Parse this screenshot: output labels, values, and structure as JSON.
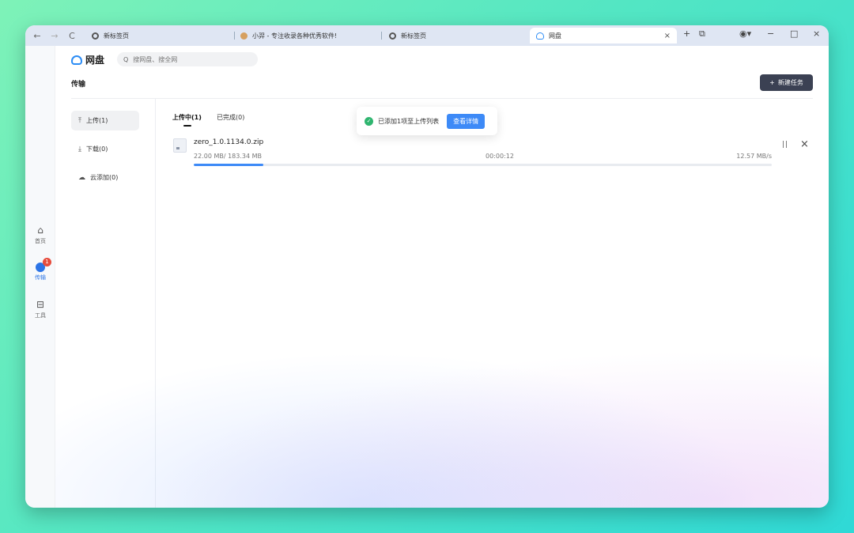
{
  "browser": {
    "tabs": [
      {
        "label": "新标签页"
      },
      {
        "label": "小羿 - 专注收录各种优秀软件!"
      },
      {
        "label": "新标签页"
      },
      {
        "label": "网盘"
      }
    ]
  },
  "app": {
    "logo_text": "网盘",
    "search_placeholder": "搜网盘、搜全网",
    "page_title": "传输",
    "new_task_label": "新建任务"
  },
  "sidebar": {
    "items": [
      {
        "label": "首页"
      },
      {
        "label": "传输",
        "badge": "1"
      },
      {
        "label": "工具"
      }
    ]
  },
  "categories": [
    {
      "label": "上传(1)"
    },
    {
      "label": "下载(0)"
    },
    {
      "label": "云添加(0)"
    }
  ],
  "subtabs": [
    {
      "label": "上传中(1)"
    },
    {
      "label": "已完成(0)"
    }
  ],
  "file": {
    "name": "zero_1.0.1134.0.zip",
    "size": "22.00 MB/ 183.34 MB",
    "time": "00:00:12",
    "speed": "12.57 MB/s",
    "progress": 0.12
  },
  "toast": {
    "message": "已添加1项至上传列表",
    "button": "查看详情"
  },
  "colors": {
    "accent": "#3d8af7",
    "success": "#2fb56f",
    "badge": "#e74c3c",
    "dark_button": "#3b4153"
  }
}
